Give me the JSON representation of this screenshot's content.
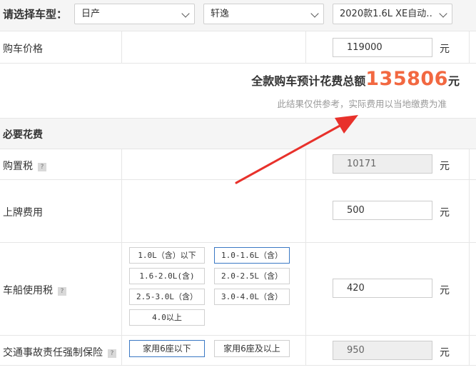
{
  "header": {
    "title": "请选择车型：",
    "brand": "日产",
    "series": "轩逸",
    "model": "2020款1.6L XE自动…"
  },
  "price": {
    "label": "购车价格",
    "value": "119000",
    "unit": "元"
  },
  "total": {
    "prefix": "全款购车预计花费总额",
    "amount": "135806",
    "unit": "元",
    "note": "此结果仅供参考，实际费用以当地缴费为准"
  },
  "section_title": "必要花费",
  "purchase_tax": {
    "label": "购置税",
    "help": "?",
    "value": "10171",
    "unit": "元"
  },
  "plate_fee": {
    "label": "上牌费用",
    "value": "500",
    "unit": "元"
  },
  "vessel_tax": {
    "label": "车船使用税",
    "help": "?",
    "options": [
      "1.0L（含）以下",
      "1.0-1.6L（含）",
      "1.6-2.0L(含)",
      "2.0-2.5L（含）",
      "2.5-3.0L（含）",
      "3.0-4.0L（含）",
      "4.0以上"
    ],
    "selected": "1.0-1.6L（含）",
    "value": "420",
    "unit": "元"
  },
  "insurance": {
    "label": "交通事故责任强制保险",
    "help": "?",
    "options": [
      "家用6座以下",
      "家用6座及以上"
    ],
    "selected": "家用6座以下",
    "value": "950",
    "unit": "元"
  },
  "colors": {
    "accent": "#f26841",
    "arrow": "#e8312b",
    "selected_border": "#3a78c4"
  }
}
